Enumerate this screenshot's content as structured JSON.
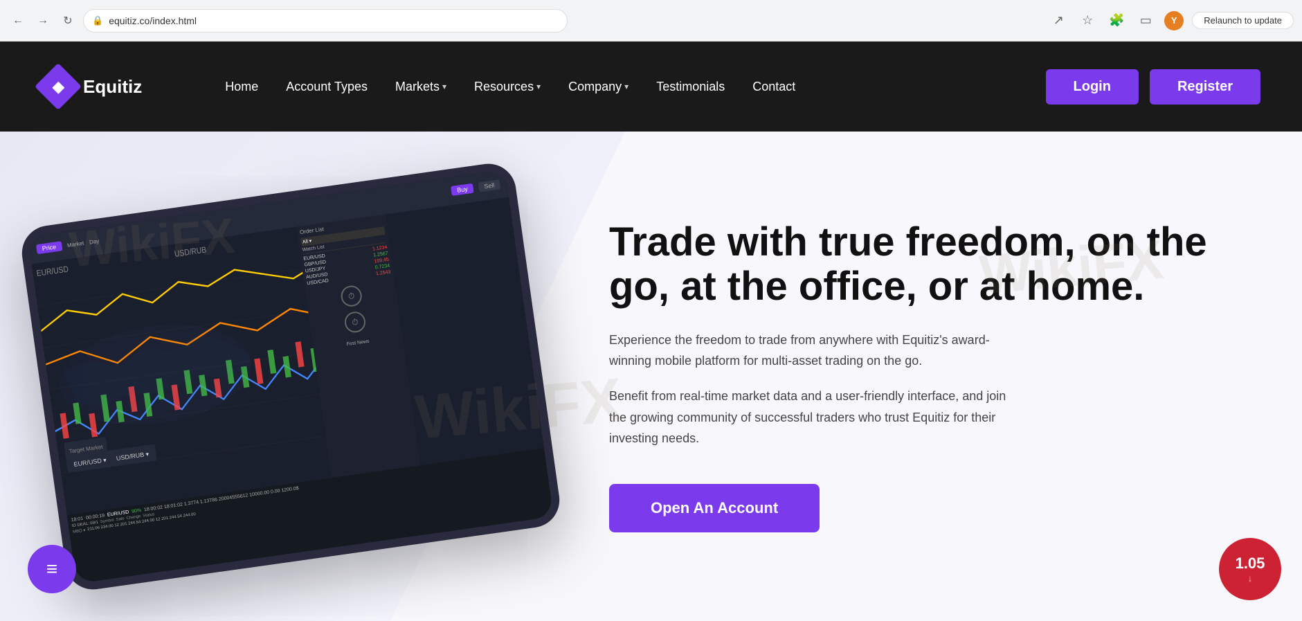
{
  "browser": {
    "url": "equitiz.co/index.html",
    "relaunch_label": "Relaunch to update",
    "back_icon": "←",
    "forward_icon": "→",
    "refresh_icon": "↻",
    "user_avatar": "Y",
    "lock_icon": "🔒"
  },
  "navbar": {
    "logo_text": "Equitiz",
    "links": [
      {
        "label": "Home",
        "has_dropdown": false
      },
      {
        "label": "Account Types",
        "has_dropdown": false
      },
      {
        "label": "Markets",
        "has_dropdown": true
      },
      {
        "label": "Resources",
        "has_dropdown": true
      },
      {
        "label": "Company",
        "has_dropdown": true
      },
      {
        "label": "Testimonials",
        "has_dropdown": false
      },
      {
        "label": "Contact",
        "has_dropdown": false
      }
    ],
    "login_label": "Login",
    "register_label": "Register"
  },
  "hero": {
    "title": "Trade with true freedom, on the go, at the office, or at home.",
    "desc1": "Experience the freedom to trade from anywhere with Equitiz's award-winning mobile platform for multi-asset trading on the go.",
    "desc2": "Benefit from real-time market data and a user-friendly interface, and join the growing community of successful traders who trust Equitiz for their investing needs.",
    "cta_label": "Open An Account"
  },
  "price_ticker": {
    "value": "1.05",
    "arrow": "↓"
  },
  "chat": {
    "icon": "≡"
  }
}
